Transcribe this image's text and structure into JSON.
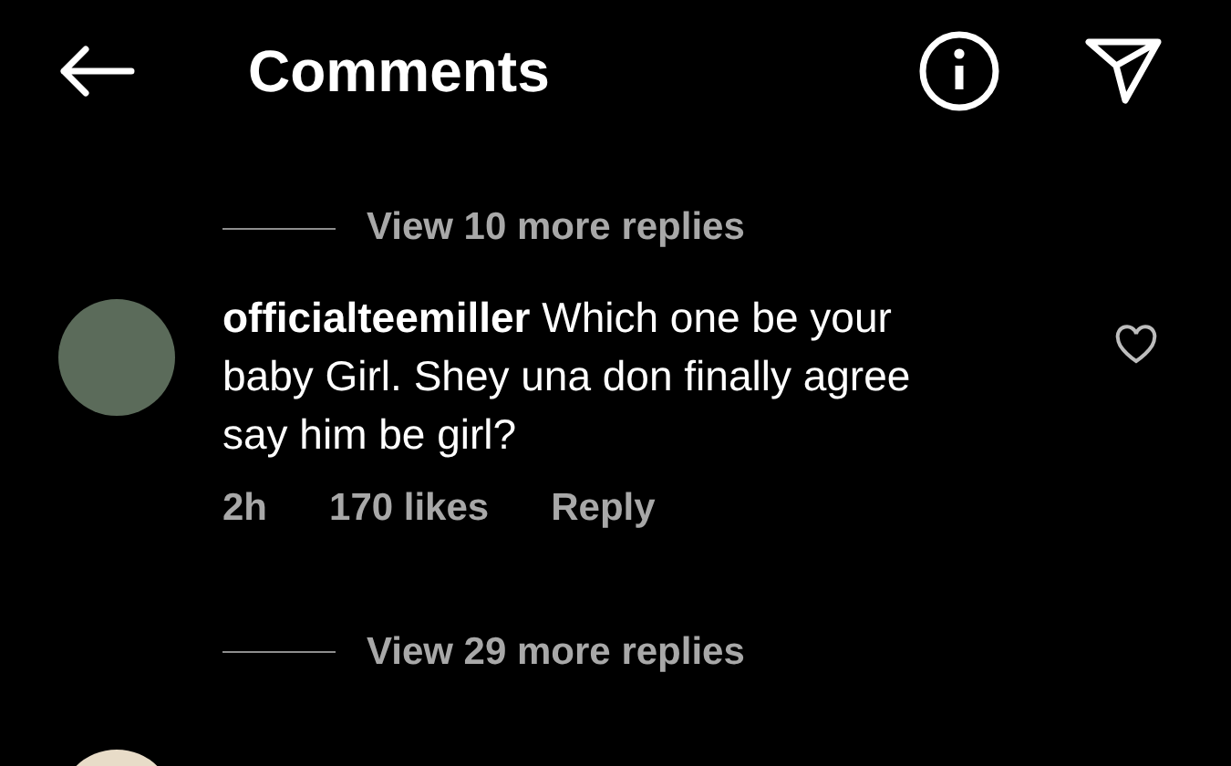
{
  "header": {
    "title": "Comments"
  },
  "items": [
    {
      "kind": "view_replies",
      "label": "View 10 more replies"
    },
    {
      "kind": "comment",
      "username": "officialteemiller",
      "text": "Which one be your baby Girl. Shey una don finally agree say him be girl?",
      "time": "2h",
      "likes": "170 likes",
      "reply": "Reply",
      "liked": false
    },
    {
      "kind": "view_replies",
      "label": "View 29 more replies"
    },
    {
      "kind": "cut_comment"
    }
  ]
}
